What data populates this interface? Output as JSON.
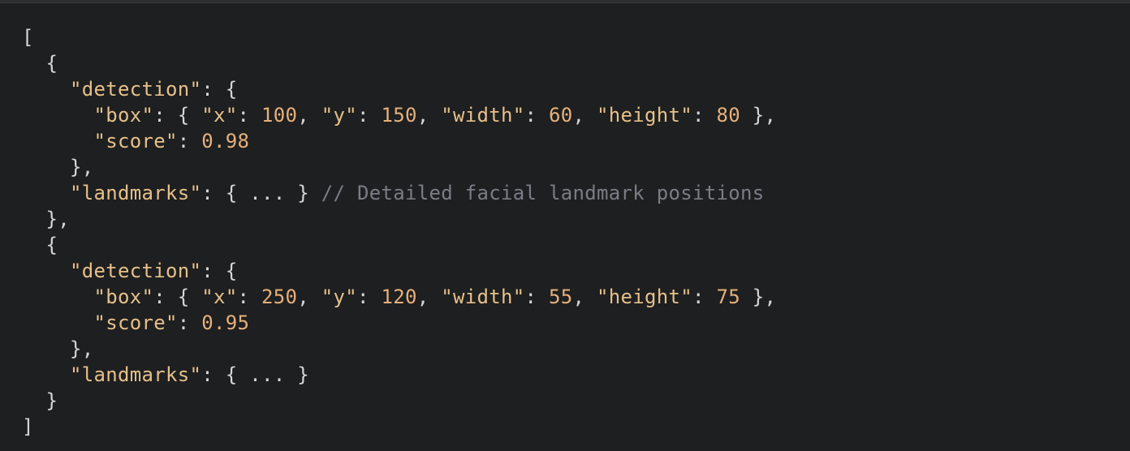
{
  "code": {
    "lines": [
      [
        {
          "text": "[",
          "kind": "punct"
        }
      ],
      [
        {
          "text": "  {",
          "kind": "punct"
        }
      ],
      [
        {
          "text": "    ",
          "kind": "punct"
        },
        {
          "text": "\"detection\"",
          "kind": "key"
        },
        {
          "text": ": {",
          "kind": "punct"
        }
      ],
      [
        {
          "text": "      ",
          "kind": "punct"
        },
        {
          "text": "\"box\"",
          "kind": "key"
        },
        {
          "text": ": { ",
          "kind": "punct"
        },
        {
          "text": "\"x\"",
          "kind": "key"
        },
        {
          "text": ": ",
          "kind": "punct"
        },
        {
          "text": "100",
          "kind": "num"
        },
        {
          "text": ", ",
          "kind": "punct"
        },
        {
          "text": "\"y\"",
          "kind": "key"
        },
        {
          "text": ": ",
          "kind": "punct"
        },
        {
          "text": "150",
          "kind": "num"
        },
        {
          "text": ", ",
          "kind": "punct"
        },
        {
          "text": "\"width\"",
          "kind": "key"
        },
        {
          "text": ": ",
          "kind": "punct"
        },
        {
          "text": "60",
          "kind": "num"
        },
        {
          "text": ", ",
          "kind": "punct"
        },
        {
          "text": "\"height\"",
          "kind": "key"
        },
        {
          "text": ": ",
          "kind": "punct"
        },
        {
          "text": "80",
          "kind": "num"
        },
        {
          "text": " },",
          "kind": "punct"
        }
      ],
      [
        {
          "text": "      ",
          "kind": "punct"
        },
        {
          "text": "\"score\"",
          "kind": "key"
        },
        {
          "text": ": ",
          "kind": "punct"
        },
        {
          "text": "0.98",
          "kind": "num"
        }
      ],
      [
        {
          "text": "    },",
          "kind": "punct"
        }
      ],
      [
        {
          "text": "    ",
          "kind": "punct"
        },
        {
          "text": "\"landmarks\"",
          "kind": "key"
        },
        {
          "text": ": { ... } ",
          "kind": "punct"
        },
        {
          "text": "// Detailed facial landmark positions",
          "kind": "comment"
        }
      ],
      [
        {
          "text": "  },",
          "kind": "punct"
        }
      ],
      [
        {
          "text": "  {",
          "kind": "punct"
        }
      ],
      [
        {
          "text": "    ",
          "kind": "punct"
        },
        {
          "text": "\"detection\"",
          "kind": "key"
        },
        {
          "text": ": {",
          "kind": "punct"
        }
      ],
      [
        {
          "text": "      ",
          "kind": "punct"
        },
        {
          "text": "\"box\"",
          "kind": "key"
        },
        {
          "text": ": { ",
          "kind": "punct"
        },
        {
          "text": "\"x\"",
          "kind": "key"
        },
        {
          "text": ": ",
          "kind": "punct"
        },
        {
          "text": "250",
          "kind": "num"
        },
        {
          "text": ", ",
          "kind": "punct"
        },
        {
          "text": "\"y\"",
          "kind": "key"
        },
        {
          "text": ": ",
          "kind": "punct"
        },
        {
          "text": "120",
          "kind": "num"
        },
        {
          "text": ", ",
          "kind": "punct"
        },
        {
          "text": "\"width\"",
          "kind": "key"
        },
        {
          "text": ": ",
          "kind": "punct"
        },
        {
          "text": "55",
          "kind": "num"
        },
        {
          "text": ", ",
          "kind": "punct"
        },
        {
          "text": "\"height\"",
          "kind": "key"
        },
        {
          "text": ": ",
          "kind": "punct"
        },
        {
          "text": "75",
          "kind": "num"
        },
        {
          "text": " },",
          "kind": "punct"
        }
      ],
      [
        {
          "text": "      ",
          "kind": "punct"
        },
        {
          "text": "\"score\"",
          "kind": "key"
        },
        {
          "text": ": ",
          "kind": "punct"
        },
        {
          "text": "0.95",
          "kind": "num"
        }
      ],
      [
        {
          "text": "    },",
          "kind": "punct"
        }
      ],
      [
        {
          "text": "    ",
          "kind": "punct"
        },
        {
          "text": "\"landmarks\"",
          "kind": "key"
        },
        {
          "text": ": { ... }",
          "kind": "punct"
        }
      ],
      [
        {
          "text": "  }",
          "kind": "punct"
        }
      ],
      [
        {
          "text": "]",
          "kind": "punct"
        }
      ]
    ]
  }
}
